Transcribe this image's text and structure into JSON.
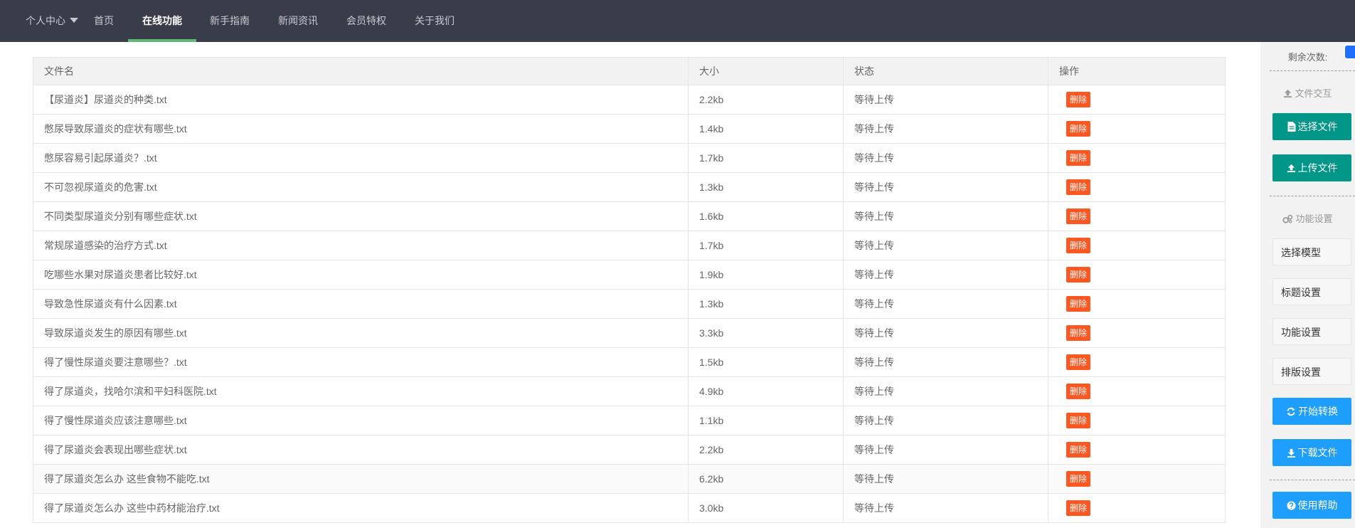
{
  "nav": {
    "user_menu": "个人中心",
    "items": [
      {
        "label": "首页"
      },
      {
        "label": "在线功能"
      },
      {
        "label": "新手指南"
      },
      {
        "label": "新闻资讯"
      },
      {
        "label": "会员特权"
      },
      {
        "label": "关于我们"
      }
    ],
    "active_index": 1
  },
  "table": {
    "headers": [
      "文件名",
      "大小",
      "状态",
      "操作"
    ],
    "delete_label": "删除",
    "rows": [
      {
        "name": "【尿道炎】尿道炎的种类.txt",
        "size": "2.2kb",
        "status": "等待上传"
      },
      {
        "name": "憋尿导致尿道炎的症状有哪些.txt",
        "size": "1.4kb",
        "status": "等待上传"
      },
      {
        "name": "憋尿容易引起尿道炎？.txt",
        "size": "1.7kb",
        "status": "等待上传"
      },
      {
        "name": "不可忽视尿道炎的危害.txt",
        "size": "1.3kb",
        "status": "等待上传"
      },
      {
        "name": "不同类型尿道炎分别有哪些症状.txt",
        "size": "1.6kb",
        "status": "等待上传"
      },
      {
        "name": "常规尿道感染的治疗方式.txt",
        "size": "1.7kb",
        "status": "等待上传"
      },
      {
        "name": "吃哪些水果对尿道炎患者比较好.txt",
        "size": "1.9kb",
        "status": "等待上传"
      },
      {
        "name": "导致急性尿道炎有什么因素.txt",
        "size": "1.3kb",
        "status": "等待上传"
      },
      {
        "name": "导致尿道炎发生的原因有哪些.txt",
        "size": "3.3kb",
        "status": "等待上传"
      },
      {
        "name": "得了慢性尿道炎要注意哪些？.txt",
        "size": "1.5kb",
        "status": "等待上传"
      },
      {
        "name": "得了尿道炎，找哈尔滨和平妇科医院.txt",
        "size": "4.9kb",
        "status": "等待上传"
      },
      {
        "name": "得了慢性尿道炎应该注意哪些.txt",
        "size": "1.1kb",
        "status": "等待上传"
      },
      {
        "name": "得了尿道炎会表现出哪些症状.txt",
        "size": "2.2kb",
        "status": "等待上传"
      },
      {
        "name": "得了尿道炎怎么办 这些食物不能吃.txt",
        "size": "6.2kb",
        "status": "等待上传"
      },
      {
        "name": "得了尿道炎怎么办 这些中药材能治疗.txt",
        "size": "3.0kb",
        "status": "等待上传"
      }
    ]
  },
  "sidebar": {
    "remaining_label": "剩余次数:",
    "file_section": "文件交互",
    "select_file": "选择文件",
    "upload_file": "上传文件",
    "func_section": "功能设置",
    "settings": [
      "选择模型",
      "标题设置",
      "功能设置",
      "排版设置"
    ],
    "start_convert": "开始转换",
    "download_file": "下载文件",
    "help": "使用帮助"
  },
  "colors": {
    "navbar": "#393d49",
    "active_underline": "#5fb878",
    "green": "#009688",
    "blue": "#1e9fff",
    "danger": "#ff5722"
  }
}
